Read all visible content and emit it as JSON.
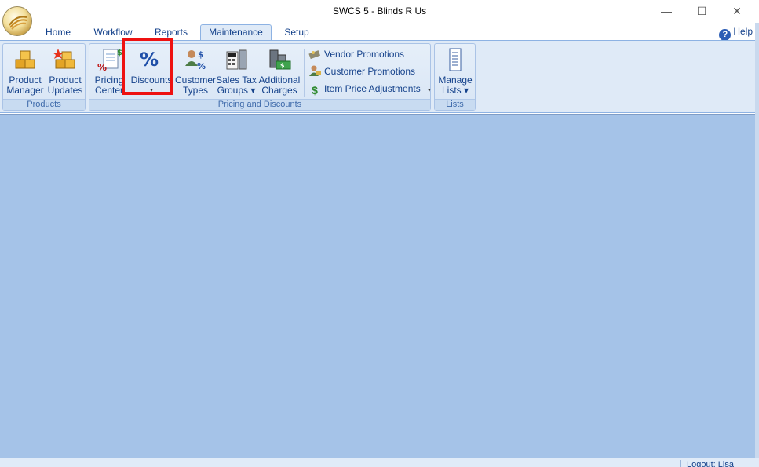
{
  "window": {
    "title": "SWCS 5 - Blinds R Us",
    "minimize_glyph": "—",
    "maximize_glyph": "☐",
    "close_glyph": "✕"
  },
  "tabs": [
    {
      "label": "Home"
    },
    {
      "label": "Workflow"
    },
    {
      "label": "Reports"
    },
    {
      "label": "Maintenance",
      "active": true
    },
    {
      "label": "Setup"
    }
  ],
  "help": {
    "label": "Help",
    "icon": "question-icon"
  },
  "ribbon": {
    "products": {
      "label": "Products",
      "buttons": [
        {
          "line1": "Product",
          "line2": "Manager",
          "icon": "boxes-icon"
        },
        {
          "line1": "Product",
          "line2": "Updates",
          "icon": "boxes-star-icon"
        }
      ]
    },
    "pricing": {
      "label": "Pricing and Discounts",
      "buttons": [
        {
          "line1": "Pricing",
          "line2": "Center",
          "icon": "price-sheet-icon"
        },
        {
          "line1": "Discounts",
          "line2": "▾",
          "icon": "percent-icon"
        },
        {
          "line1": "Customer",
          "line2": "Types",
          "icon": "customer-percent-icon"
        },
        {
          "line1": "Sales Tax",
          "line2": "Groups ▾",
          "icon": "calculator-icon"
        },
        {
          "line1": "Additional",
          "line2": "Charges",
          "icon": "money-stack-icon"
        }
      ],
      "small_buttons": [
        {
          "label": "Vendor Promotions",
          "icon": "vendor-promo-icon"
        },
        {
          "label": "Customer Promotions",
          "icon": "customer-promo-icon"
        },
        {
          "label": "Item Price Adjustments",
          "icon": "dollar-icon",
          "dropdown": "▾"
        }
      ]
    },
    "lists": {
      "label": "Lists",
      "buttons": [
        {
          "line1": "Manage",
          "line2": "Lists ▾",
          "icon": "list-document-icon"
        }
      ]
    }
  },
  "statusbar": {
    "user_panel": "Logout: Lisa"
  },
  "colors": {
    "highlight": "#ee1111",
    "workspace": "#a5c3e8",
    "ribbon_bg": "#dfeaf7",
    "text": "#15428b"
  }
}
